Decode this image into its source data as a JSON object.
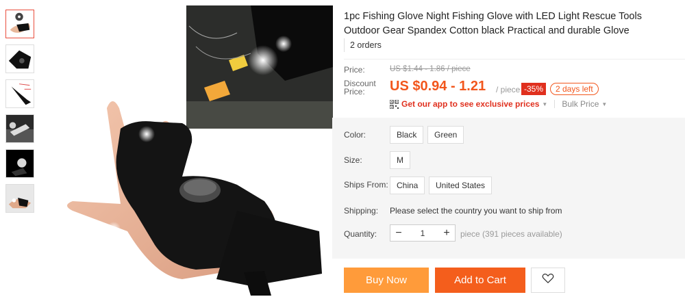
{
  "product": {
    "title": "1pc Fishing Glove Night Fishing Glove with LED Light Rescue Tools Outdoor Gear Spandex Cotton black Practical and durable Glove",
    "orders": "2 orders"
  },
  "gallery": {
    "thumbnails": [
      "glove-thumb-1",
      "glove-thumb-2",
      "glove-thumb-3",
      "glove-thumb-4",
      "glove-thumb-5",
      "glove-thumb-6"
    ],
    "main_image": "led-fishing-glove-photo"
  },
  "pricing": {
    "price_label": "Price:",
    "original_price": "US $1.44 - 1.86 / piece",
    "discount_price_label": "Discount Price:",
    "discount_price": "US $0.94 - 1.21",
    "unit": "/ piece",
    "discount_badge": "-35%",
    "days_left": "2 days left",
    "app_promo": "Get our app to see exclusive prices",
    "bulk_price": "Bulk Price"
  },
  "options": {
    "color_label": "Color:",
    "colors": [
      "Black",
      "Green"
    ],
    "size_label": "Size:",
    "sizes": [
      "M"
    ],
    "ships_from_label": "Ships From:",
    "ships_from": [
      "China",
      "United States"
    ],
    "shipping_label": "Shipping:",
    "shipping_text": "Please select the country you want to ship from",
    "quantity_label": "Quantity:",
    "quantity_value": "1",
    "quantity_minus": "−",
    "quantity_plus": "+",
    "availability": "piece (391 pieces available)"
  },
  "actions": {
    "buy_now": "Buy Now",
    "add_to_cart": "Add to Cart",
    "wishlist_icon": "heart-icon"
  },
  "colors": {
    "accent_orange": "#f2561c",
    "buy_now_bg": "#ff9b3a",
    "add_to_cart_bg": "#f45e1c",
    "badge_red": "#e0301e"
  }
}
